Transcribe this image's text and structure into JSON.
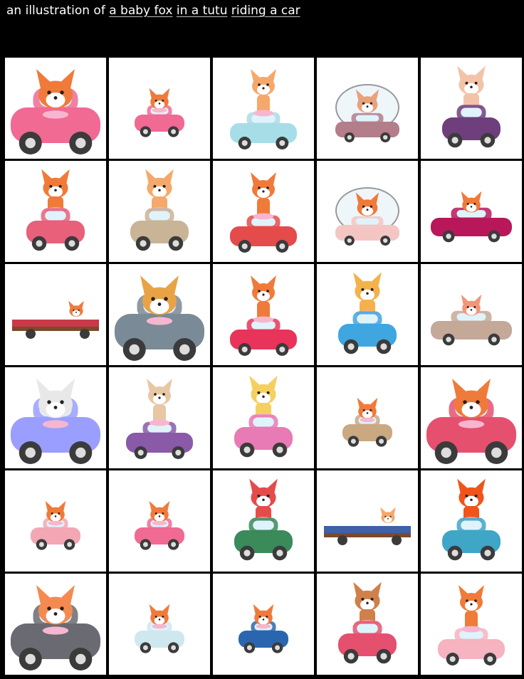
{
  "prompt": {
    "prefix": "an illustration of ",
    "phrases": [
      "a baby fox",
      "in a tutu",
      "riding a car"
    ]
  },
  "palette": {
    "fox": "#f07a3a",
    "fox_light": "#f6a86a",
    "white": "#ffffff",
    "pink": "#f06a93",
    "magenta": "#b8175a",
    "purple": "#6e3f7c",
    "blue": "#3fa6e0",
    "teal": "#7fd0e0",
    "tan": "#c9a882",
    "wheel": "#3b3b3b"
  },
  "images": [
    {
      "name": "pink-booth-car",
      "car": "#f06a93",
      "fox": "#f07a3a",
      "style": "closeup"
    },
    {
      "name": "pink-beetle",
      "car": "#f06a93",
      "fox": "#f07a3a",
      "style": "small"
    },
    {
      "name": "fox-on-blue-car",
      "car": "#a7dde6",
      "fox": "#f6a86a",
      "style": "ontop"
    },
    {
      "name": "bubble-car",
      "car": "#b37d8a",
      "fox": "#e8a27c",
      "style": "bubble"
    },
    {
      "name": "purple-car",
      "car": "#6e3f7c",
      "fox": "#f3c3a8",
      "style": "tall"
    },
    {
      "name": "pink-go-kart",
      "car": "#e8607a",
      "fox": "#f07a3a",
      "style": "tall"
    },
    {
      "name": "beige-jeep",
      "car": "#c9b497",
      "fox": "#f6a86a",
      "style": "tall"
    },
    {
      "name": "red-scooter",
      "car": "#e54b4b",
      "fox": "#f07a3a",
      "style": "ontop"
    },
    {
      "name": "glass-dome-car",
      "car": "#f3c6c4",
      "fox": "#f07a3a",
      "style": "bubble"
    },
    {
      "name": "magenta-sedan",
      "car": "#b8175a",
      "fox": "#f07a3a",
      "style": "sedan"
    },
    {
      "name": "flatbed-car",
      "car": "#c9394a",
      "fox": "#f07a3a",
      "style": "flat"
    },
    {
      "name": "blue-collage",
      "car": "#7a8a96",
      "fox": "#e8a346",
      "style": "closeup"
    },
    {
      "name": "tall-fox-red-car",
      "car": "#e8345a",
      "fox": "#f07a3a",
      "style": "ontop"
    },
    {
      "name": "blue-bumper-car",
      "car": "#3fa6e0",
      "fox": "#f5b14a",
      "style": "tall"
    },
    {
      "name": "brown-convertible",
      "car": "#c4a898",
      "fox": "#f39578",
      "style": "sedan"
    },
    {
      "name": "sketch-fox",
      "car": "#9a9eff",
      "fox": "#e8e8e8",
      "style": "closeup"
    },
    {
      "name": "purple-kart-tan-fox",
      "car": "#8a5aa8",
      "fox": "#e8c7a5",
      "style": "ontop"
    },
    {
      "name": "yellow-fox-pink-car",
      "car": "#e87ab5",
      "fox": "#f5d060",
      "style": "tall"
    },
    {
      "name": "tan-beetle",
      "car": "#c9a882",
      "fox": "#f07a3a",
      "style": "small"
    },
    {
      "name": "pink-hippo-car",
      "car": "#e5506e",
      "fox": "#f07a3a",
      "style": "closeup"
    },
    {
      "name": "tiny-pink-car",
      "car": "#f3a6b3",
      "fox": "#f07a3a",
      "style": "small"
    },
    {
      "name": "circle-badge",
      "car": "#f06a93",
      "fox": "#f07a3a",
      "style": "small"
    },
    {
      "name": "green-tractor",
      "car": "#3a8a5a",
      "fox": "#e54b4b",
      "style": "tall"
    },
    {
      "name": "blue-truck",
      "car": "#4060a8",
      "fox": "#f6a86a",
      "style": "flat"
    },
    {
      "name": "teal-canopy-car",
      "car": "#3fa6c8",
      "fox": "#f0541a",
      "style": "tall"
    },
    {
      "name": "orange-cat-car",
      "car": "#6a6a72",
      "fox": "#f58a50",
      "style": "closeup"
    },
    {
      "name": "mini-robot-car",
      "car": "#cfe8ef",
      "fox": "#f07a3a",
      "style": "small"
    },
    {
      "name": "framed-blue-car",
      "car": "#2a66b0",
      "fox": "#f07a3a",
      "style": "small"
    },
    {
      "name": "pink-retro-car",
      "car": "#e5506e",
      "fox": "#d0804a",
      "style": "tall"
    },
    {
      "name": "pink-scooter",
      "car": "#f6b3c0",
      "fox": "#f07a3a",
      "style": "ontop"
    }
  ]
}
